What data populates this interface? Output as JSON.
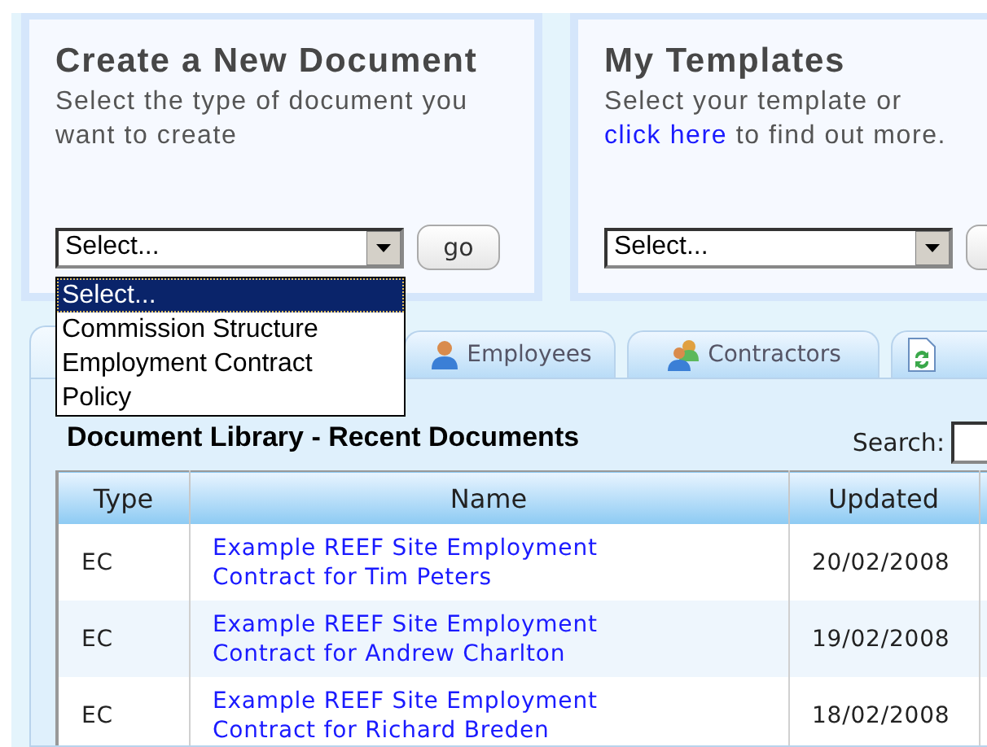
{
  "panels": [
    {
      "title": "Create a New Document",
      "description": [
        {
          "text": "Select the type of document you want to create",
          "kind": "text"
        }
      ],
      "select": {
        "value": "Select..."
      },
      "button": "go"
    },
    {
      "title": "My Templates",
      "description": [
        {
          "text": "Select your template or ",
          "kind": "text"
        },
        {
          "text": "click ",
          "kind": "link"
        },
        {
          "text": "here",
          "kind": "link"
        },
        {
          "text": " to find out more.",
          "kind": "text"
        }
      ],
      "select": {
        "value": "Select..."
      }
    }
  ],
  "dropdown": {
    "options": [
      {
        "label": "Select...",
        "selected": true
      },
      {
        "label": "Commission Structure",
        "selected": false
      },
      {
        "label": "Employment Contract",
        "selected": false
      },
      {
        "label": "Policy",
        "selected": false
      }
    ]
  },
  "tabs": [
    {
      "selected": true
    },
    {
      "label": "Employees",
      "selected": false
    },
    {
      "label": "Contractors",
      "selected": false
    },
    {
      "selected": false
    }
  ],
  "library": {
    "title": "Document Library - Recent Documents",
    "search_label": "Search:",
    "columns": [
      "Type",
      "Name",
      "Updated"
    ],
    "rows": [
      {
        "type": "EC",
        "name": "Example REEF Site Employment Contract for Tim Peters",
        "updated": "20/02/2008"
      },
      {
        "type": "EC",
        "name": "Example REEF Site Employment Contract for Andrew Charlton",
        "updated": "19/02/2008"
      },
      {
        "type": "EC",
        "name": "Example REEF Site Employment Contract for Richard Breden",
        "updated": "18/02/2008"
      }
    ]
  }
}
